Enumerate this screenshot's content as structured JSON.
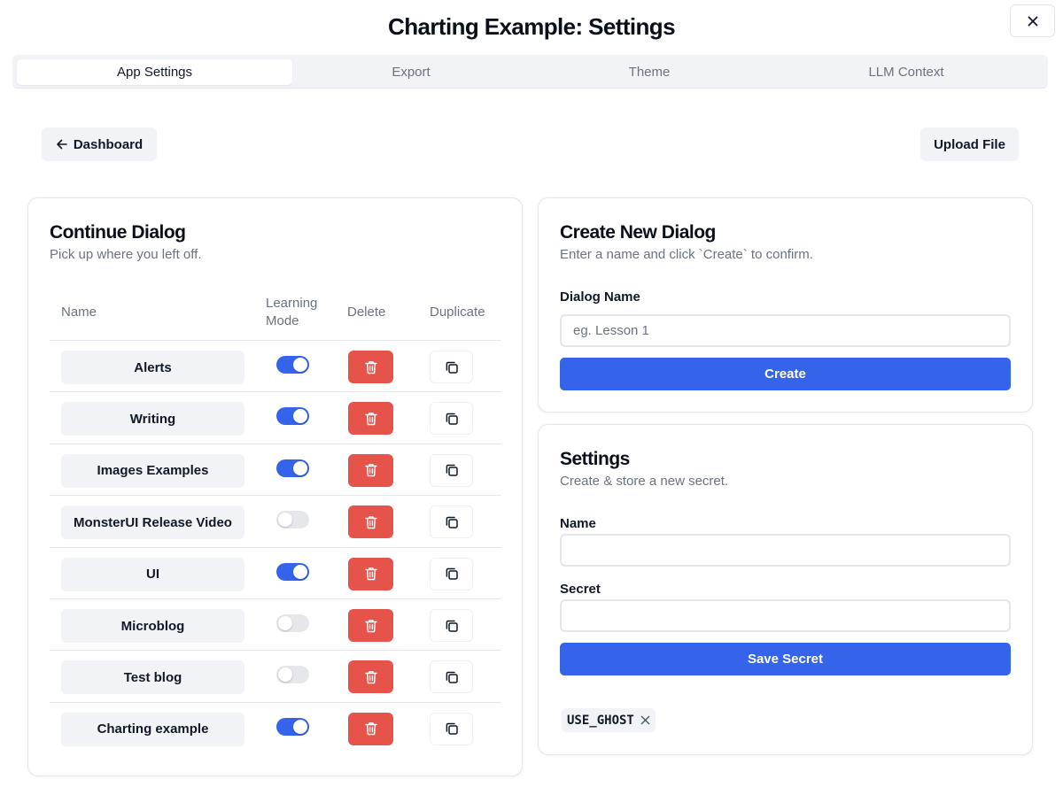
{
  "window": {
    "title": "Charting Example: Settings"
  },
  "tabs": [
    {
      "label": "App Settings",
      "active": true
    },
    {
      "label": "Export",
      "active": false
    },
    {
      "label": "Theme",
      "active": false
    },
    {
      "label": "LLM Context",
      "active": false
    }
  ],
  "toolbar": {
    "dashboard_label": "Dashboard",
    "upload_label": "Upload File"
  },
  "continue_dialog": {
    "title": "Continue Dialog",
    "subtitle": "Pick up where you left off.",
    "columns": {
      "name": "Name",
      "learning_mode": "Learning Mode",
      "delete": "Delete",
      "duplicate": "Duplicate"
    },
    "rows": [
      {
        "name": "Alerts",
        "learning_mode": true
      },
      {
        "name": "Writing",
        "learning_mode": true
      },
      {
        "name": "Images Examples",
        "learning_mode": true
      },
      {
        "name": "MonsterUI Release Video",
        "learning_mode": false
      },
      {
        "name": "UI",
        "learning_mode": true
      },
      {
        "name": "Microblog",
        "learning_mode": false
      },
      {
        "name": "Test blog",
        "learning_mode": false
      },
      {
        "name": "Charting example",
        "learning_mode": true
      }
    ]
  },
  "create_dialog": {
    "title": "Create New Dialog",
    "subtitle": "Enter a name and click `Create` to confirm.",
    "field_label": "Dialog Name",
    "field_value": "",
    "field_placeholder": "eg. Lesson 1",
    "button_label": "Create"
  },
  "secrets": {
    "title": "Settings",
    "subtitle": "Create & store a new secret.",
    "name_label": "Name",
    "name_value": "",
    "secret_label": "Secret",
    "secret_value": "",
    "button_label": "Save Secret",
    "chips": [
      {
        "label": "USE_GHOST"
      }
    ]
  },
  "colors": {
    "accent": "#3563e9",
    "danger": "#e5534b",
    "muted_bg": "#f1f3f6"
  },
  "icons": {
    "close": "close-icon",
    "back": "arrow-left-icon",
    "delete": "trash-icon",
    "duplicate": "copy-icon",
    "chip_remove": "close-icon"
  }
}
